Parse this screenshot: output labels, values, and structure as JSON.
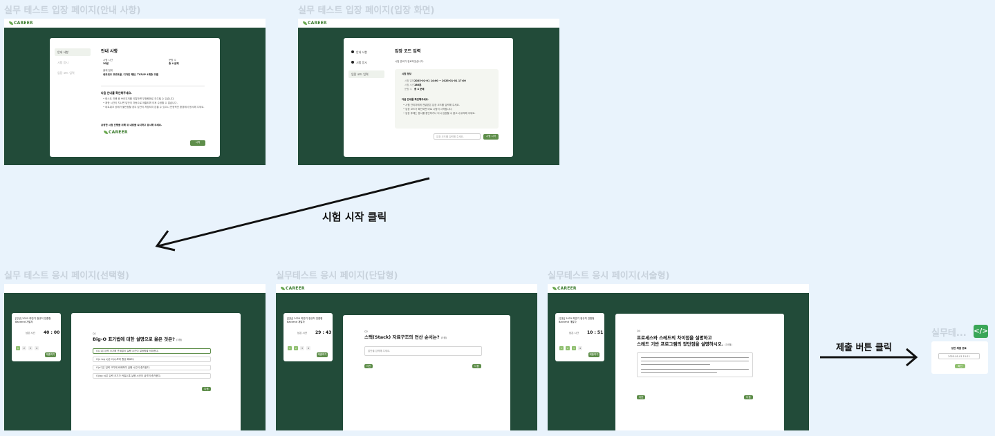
{
  "frames": {
    "guide": {
      "title": "실무 테스트 입장 페이지(안내 사항)"
    },
    "entry": {
      "title": "실무 테스트 입장 페이지(입장 화면)"
    },
    "choice": {
      "title": "실무 테스트 응시 페이지(선택형)"
    },
    "short": {
      "title": "실무테스트 응시 페이지(단답형)"
    },
    "essay": {
      "title": "실무테스트 응시 페이지(서술형)"
    },
    "submit": {
      "title": "실무테... "
    }
  },
  "logo": "CAREER",
  "guide": {
    "side": [
      "안내 사항",
      "시험 응시",
      "입장 코드 입력"
    ],
    "heading": "안내 사항",
    "field1_label": "시험 시간",
    "field1_value": "30분",
    "field2_label": "문항 수",
    "field2_value": "총 4 문제",
    "field3_label": "출제 범위",
    "field3_value": "네트워크 프로토콜, 디자인 패턴, TCP/IP 4계층 모델",
    "notice_title": "다음 안내를 확인해주세요.",
    "notice_lines": [
      "• 테스트 진행 중 브라우저를 이탈하면 부정행위로 간주될 수 있습니다.",
      "• 제한 시간이 지나면 답안이 자동으로 제출되며 이후 수정할 수 없습니다.",
      "• 네트워크 상태가 불안정할 경우 답안이 저장되지 않을 수 있으니 안정적인 환경에서 응시해 주세요."
    ],
    "closing": "공정한 시험 진행을 위해 위 내용을 숙지하고 응시해 주세요.",
    "button": "시작"
  },
  "entry": {
    "side": [
      "안내 사항",
      "시험 응시",
      "입장 코드 입력"
    ],
    "heading": "입장 코드 입력",
    "sub": "시험 준비가 완료되었습니다.",
    "info_title": "시험 정보",
    "info_rows": [
      {
        "k": "시험 일정",
        "v": "2025-01-01 14:00 ~ 2025-01-01 17:00"
      },
      {
        "k": "시험 시간",
        "v": "180분"
      },
      {
        "k": "문항 수",
        "v": "총 4 문제"
      }
    ],
    "notice_title": "다음 안내를 확인해주세요.",
    "notice_lines": [
      "• 시험 관리자에게 전달받은 입장 코드를 입력해 주세요.",
      "• 입장 코드가 확인되면 바로 시험이 시작됩니다.",
      "• 입장 후에는 응시를 중단하거나 다시 입장할 수 없으니 유의해 주세요."
    ],
    "input_placeholder": "입장 코드를 입력해 주세요.",
    "button": "시험 시작"
  },
  "arrow_label": "시험 시작 클릭",
  "choice": {
    "exam_title": "[인턴] 2025 하반기 정규직 전환형 Backend 개발자",
    "timer_label": "남은 시간",
    "timer": "40 : 00",
    "nums": [
      "1",
      "2",
      "3",
      "4"
    ],
    "submit": "제출하기",
    "q_tag": "Q1",
    "question": "Big-O 표기법에 대한 설명으로 옳은 것은?",
    "q_points": "(5점)",
    "options": [
      "O(1)은 입력 크기에 관계없이 실행 시간이 일정함을 의미한다.",
      "O(n log n)은 O(n)보다 항상 빠르다.",
      "O(n²)은 입력 크기에 비례하여 실행 시간이 증가한다.",
      "O(log n)은 입력 크기가 커질수록 실행 시간이 급격히 증가한다."
    ],
    "next": "다음"
  },
  "short": {
    "exam_title": "[인턴] 2025 하반기 정규직 전환형 Backend 개발자",
    "timer_label": "남은 시간",
    "timer": "29 : 43",
    "nums": [
      "1",
      "2",
      "3",
      "4"
    ],
    "submit": "제출하기",
    "q_tag": "Q2",
    "question": "스택(Stack) 자료구조의 연산 순서는?",
    "q_points": "(5점)",
    "answer_placeholder": "답안을 입력해 주세요.",
    "prev": "이전",
    "next": "다음"
  },
  "essay": {
    "exam_title": "[인턴] 2025 하반기 정규직 전환형 Backend 개발자",
    "timer_label": "남은 시간",
    "timer": "10 : 51",
    "nums": [
      "1",
      "2",
      "3",
      "4"
    ],
    "submit": "제출하기",
    "q_tag": "Q4",
    "question_line1": "프로세스와 스레드의 차이점을 설명하고",
    "question_line2": "스레드 기반 프로그램의 장단점을 설명하시오.",
    "q_points": "(10점)",
    "prev": "이전",
    "next": "다음"
  },
  "submit_label": "제출 버튼 클릭",
  "submit_frame": {
    "heading": "답안 제출 완료",
    "box": "2025-01-01 15:21",
    "button": "확인"
  },
  "icon": "code-icon"
}
